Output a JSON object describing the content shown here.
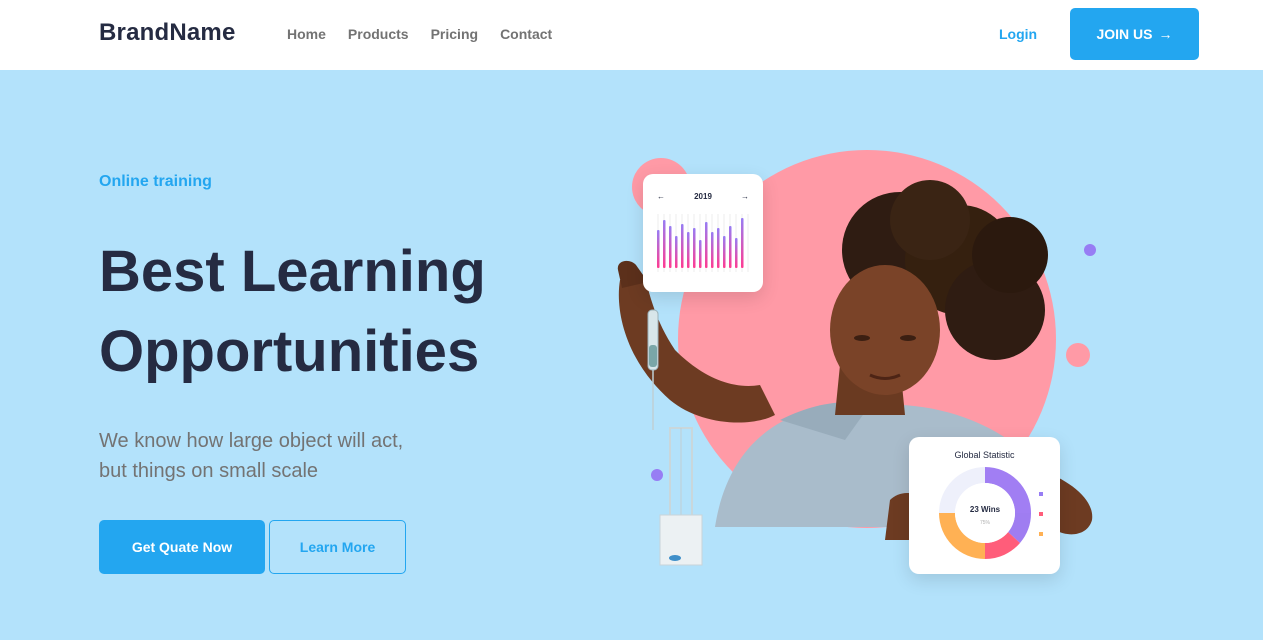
{
  "brand": "BrandName",
  "nav": [
    "Home",
    "Products",
    "Pricing",
    "Contact"
  ],
  "auth": {
    "login": "Login",
    "join": "JOIN US",
    "join_icon": "arrow-right-icon"
  },
  "hero": {
    "eyebrow": "Online training",
    "title_line1": "Best Learning",
    "title_line2": "Opportunities",
    "subtitle_line1": "We know how large object will act,",
    "subtitle_line2": "but things on small scale",
    "primary_button": "Get Quate Now",
    "secondary_button": "Learn More"
  },
  "bar_card": {
    "year": "2019",
    "prev_icon": "arrow-left-icon",
    "next_icon": "arrow-right-icon"
  },
  "donut_card": {
    "title": "Global Statistic",
    "center_label": "23 Wins",
    "center_sub": "75%"
  },
  "colors": {
    "accent": "#23a6f0",
    "heading": "#252b42",
    "muted": "#737373",
    "hero_bg": "#b3e2fb",
    "pink": "#ff9aa6",
    "purple": "#977df4",
    "orange": "#ffb154"
  }
}
